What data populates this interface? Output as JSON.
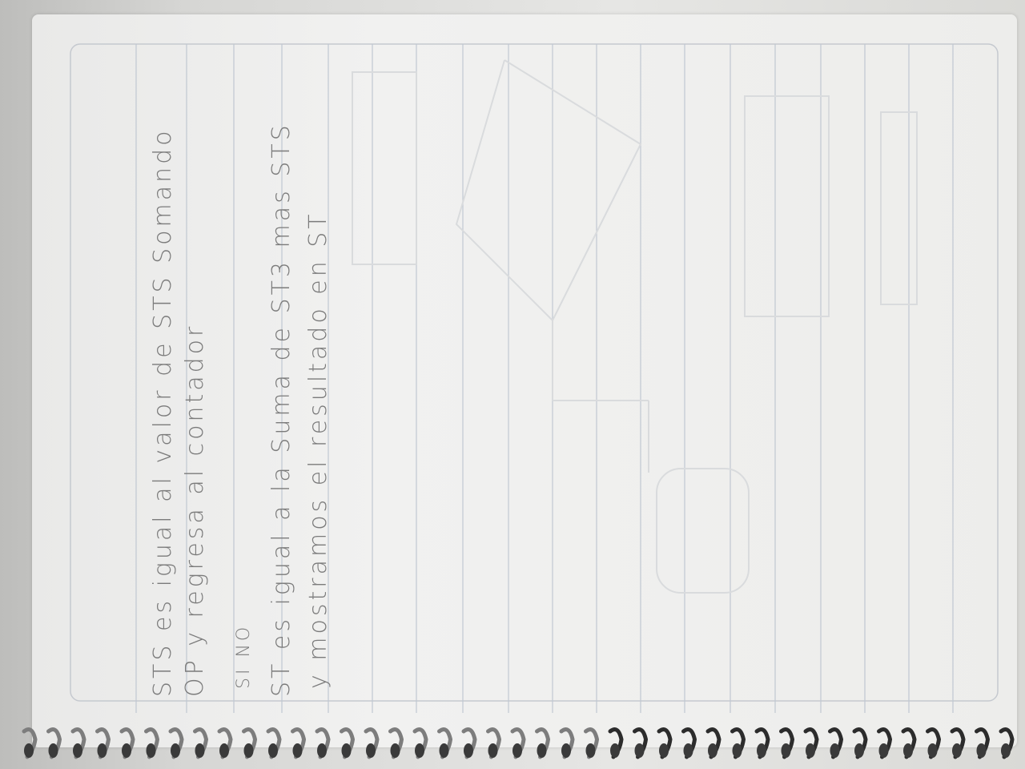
{
  "notes": {
    "line1": "STS es igual al valor de STS Somando",
    "line2": "OP y regresa al contador",
    "line3": "SI NO",
    "line4": "ST es igual a la Suma de ST3 mas STS",
    "line5": "y mostramos el resultado en ST"
  },
  "colors": {
    "pencil": "#7b7b7b",
    "paper": "#efefee",
    "rule": "#b9c2cf",
    "spiral": "#2c2c2c"
  }
}
